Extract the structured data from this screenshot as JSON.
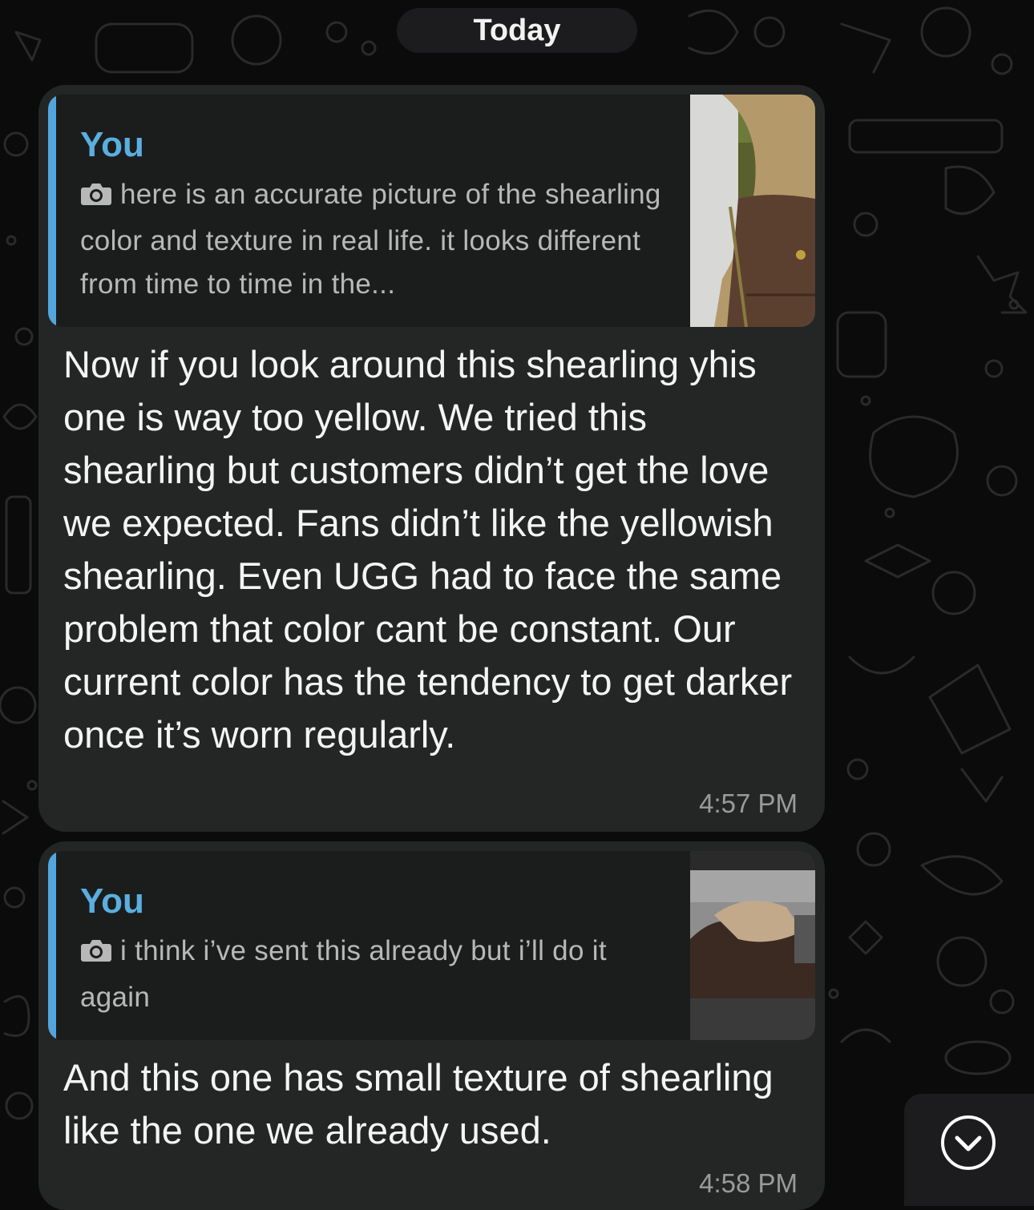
{
  "date_separator": "Today",
  "messages": [
    {
      "quote": {
        "author": "You",
        "icon": "camera-icon",
        "text": "here is an accurate picture of the shearling color and texture in real life. it looks different from time to time in the..."
      },
      "text": "Now if you look around this shearling yhis one is way too yellow. We tried this shearling but customers didn’t get the love we expected. Fans didn’t like the yellowish shearling. Even UGG had to face the same problem that color cant be constant. Our current color has the tendency to get darker once it’s worn regularly.",
      "time": "4:57 PM"
    },
    {
      "quote": {
        "author": "You",
        "icon": "camera-icon",
        "text": "i think i’ve sent this already but i’ll do it again"
      },
      "text": "And this one has small texture of shearling like the one we already used.",
      "time": "4:58 PM"
    }
  ],
  "scroll_button": {
    "icon": "chevron-down-icon"
  },
  "colors": {
    "background": "#0b0b0b",
    "bubble": "#242626",
    "quote_background": "#1b1d1d",
    "quote_accent": "#53a6dd",
    "quote_author": "#5aaee0"
  }
}
